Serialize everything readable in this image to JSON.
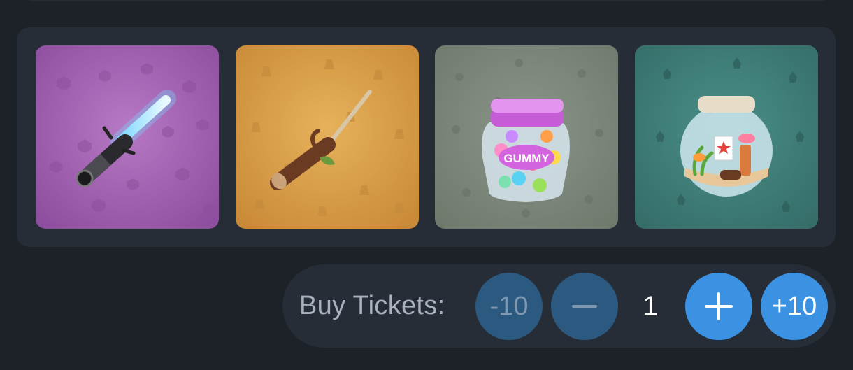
{
  "items": [
    {
      "name": "lightsaber",
      "bg": "#a060b0"
    },
    {
      "name": "stick",
      "bg": "#d39a45"
    },
    {
      "name": "gummy jar",
      "bg": "#7b8579",
      "jar_label": "GUMMY"
    },
    {
      "name": "fishbowl",
      "bg": "#3f7e79"
    }
  ],
  "buy": {
    "label": "Buy Tickets:",
    "minus10": "-10",
    "minus_icon": "minus-icon",
    "quantity": "1",
    "plus_icon": "plus-icon",
    "plus10": "+10"
  }
}
